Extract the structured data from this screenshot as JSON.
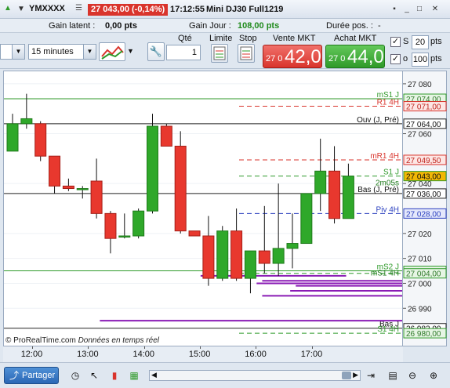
{
  "titlebar": {
    "symbol": "YMXXXX",
    "price": "27 043,00 (-0,14%)",
    "time": "17:12:55",
    "name": "Mini DJ30 Full1219"
  },
  "info": {
    "gain_latent_label": "Gain latent :",
    "gain_latent_value": "0,00 pts",
    "gain_jour_label": "Gain Jour :",
    "gain_jour_value": "108,00 pts",
    "duree_label": "Durée pos. :",
    "duree_value": "-"
  },
  "order": {
    "interval": "15 minutes",
    "qty_label": "Qté",
    "qty_value": "1",
    "limit_label": "Limite",
    "stop_label": "Stop",
    "sell_label": "Vente MKT",
    "sell_small": "27 0",
    "sell_big": "42,0",
    "buy_label": "Achat MKT",
    "buy_small": "27 0",
    "buy_big": "44,0",
    "s_label": "S",
    "s_value": "20",
    "o_value": "100",
    "pts": "pts"
  },
  "chart_data": {
    "type": "candlestick",
    "y_range": [
      26975,
      27085
    ],
    "y_ticks": [
      "27 080",
      "27 060",
      "27 040",
      "27 020",
      "27 010",
      "27 000",
      "26 990"
    ],
    "x_ticks": [
      "12:00",
      "13:00",
      "14:00",
      "15:00",
      "16:00",
      "17:00"
    ],
    "candles": [
      {
        "o": 27053,
        "h": 27068,
        "l": 27053,
        "c": 27064
      },
      {
        "o": 27064,
        "h": 27076,
        "l": 27062,
        "c": 27066
      },
      {
        "o": 27064,
        "h": 27065,
        "l": 27049,
        "c": 27051
      },
      {
        "o": 27051,
        "h": 27051,
        "l": 27036,
        "c": 27039
      },
      {
        "o": 27039,
        "h": 27042,
        "l": 27037,
        "c": 27038
      },
      {
        "o": 27038,
        "h": 27039,
        "l": 27034,
        "c": 27038
      },
      {
        "o": 27041,
        "h": 27050,
        "l": 27026,
        "c": 27028
      },
      {
        "o": 27028,
        "h": 27029,
        "l": 27012,
        "c": 27018
      },
      {
        "o": 27019,
        "h": 27028,
        "l": 27018,
        "c": 27019
      },
      {
        "o": 27019,
        "h": 27030,
        "l": 27018,
        "c": 27029
      },
      {
        "o": 27029,
        "h": 27068,
        "l": 27028,
        "c": 27063
      },
      {
        "o": 27063,
        "h": 27064,
        "l": 27055,
        "c": 27055
      },
      {
        "o": 27055,
        "h": 27061,
        "l": 27020,
        "c": 27021
      },
      {
        "o": 27021,
        "h": 27021,
        "l": 27019,
        "c": 27019
      },
      {
        "o": 27019,
        "h": 27027,
        "l": 26999,
        "c": 27002
      },
      {
        "o": 27002,
        "h": 27023,
        "l": 27001,
        "c": 27021
      },
      {
        "o": 27021,
        "h": 27030,
        "l": 27001,
        "c": 27002
      },
      {
        "o": 27002,
        "h": 27013,
        "l": 26996,
        "c": 27013
      },
      {
        "o": 27013,
        "h": 27031,
        "l": 27004,
        "c": 27008
      },
      {
        "o": 27008,
        "h": 27040,
        "l": 27003,
        "c": 27014
      },
      {
        "o": 27014,
        "h": 27028,
        "l": 27006,
        "c": 27016
      },
      {
        "o": 27016,
        "h": 27028,
        "l": 27016,
        "c": 27036
      },
      {
        "o": 27036,
        "h": 27058,
        "l": 27029,
        "c": 27045
      },
      {
        "o": 27045,
        "h": 27055,
        "l": 27024,
        "c": 27026
      },
      {
        "o": 27026,
        "h": 27048,
        "l": 27026,
        "c": 27043
      }
    ],
    "levels": [
      {
        "label": "mS1 J",
        "value": 27074.0,
        "price": "27 074,00",
        "color": "#2f9a2a",
        "style": "solid",
        "tag_bg": "#e6f5e4",
        "tag_fg": "#2f7a2a"
      },
      {
        "label": "R1 4H",
        "value": 27071.0,
        "price": "27 071,00",
        "color": "#d9342c",
        "style": "dashed",
        "tag_bg": "#fde6e4",
        "tag_fg": "#c0251e"
      },
      {
        "label": "Ouv (J, Pré)",
        "value": 27064.0,
        "price": "27 064,00",
        "color": "#222222",
        "style": "solid",
        "tag_bg": "#ffffff",
        "tag_fg": "#111111"
      },
      {
        "label": "mR1 4H",
        "value": 27049.5,
        "price": "27 049,50",
        "color": "#d9342c",
        "style": "dashed",
        "tag_bg": "#fde6e4",
        "tag_fg": "#c0251e"
      },
      {
        "label": "S1 J",
        "value": 27043.0,
        "price": "27 043,00",
        "color": "#2f9a2a",
        "style": "dashed",
        "tag_bg": "#f2b705",
        "tag_fg": "#111111"
      },
      {
        "label": "Bas (J, Pré)",
        "value": 27036.0,
        "price": "27 036,00",
        "color": "#222222",
        "style": "solid",
        "tag_bg": "#ffffff",
        "tag_fg": "#111111"
      },
      {
        "label": "Piv 4H",
        "value": 27028.0,
        "price": "27 028,00",
        "color": "#2a3fbf",
        "style": "dashed",
        "tag_bg": "#e4e8fb",
        "tag_fg": "#2a3fbf"
      },
      {
        "label": "mS2 J",
        "value": 27005.0,
        "price": "27 005,00",
        "color": "#2f9a2a",
        "style": "solid",
        "tag_bg": "#e6f5e4",
        "tag_fg": "#2f7a2a"
      },
      {
        "label": "",
        "value": 27004.0,
        "price": "27 004,00",
        "color": "#2f9a2a",
        "style": "dashed",
        "tag_bg": "#e6f5e4",
        "tag_fg": "#2f7a2a"
      },
      {
        "label": "Bas J",
        "value": 26982.0,
        "price": "26 982,00",
        "color": "#222222",
        "style": "solid",
        "tag_bg": "#ffffff",
        "tag_fg": "#111111"
      },
      {
        "label": "S1 4H",
        "value": 26980.0,
        "price": "26 980,00",
        "color": "#2f9a2a",
        "style": "dashed",
        "tag_bg": "#e6f5e4",
        "tag_fg": "#2f7a2a"
      }
    ],
    "extra_labels": [
      {
        "text": "2m05s",
        "value": 27039.2
      },
      {
        "text": "mS1 4H",
        "value": 27003.2
      }
    ],
    "volume_profile": [
      {
        "y": 27003.0,
        "t0": 15,
        "t1": 17.6
      },
      {
        "y": 27001.0,
        "t0": 16.1,
        "t1": 19.2
      },
      {
        "y": 27000.0,
        "t0": 16.0,
        "t1": 21
      },
      {
        "y": 26999.0,
        "t0": 16.7,
        "t1": 21
      },
      {
        "y": 26997.0,
        "t0": 16.6,
        "t1": 20.5
      },
      {
        "y": 26995.0,
        "t0": 16.1,
        "t1": 19.5
      },
      {
        "y": 26985.0,
        "t0": 13.2,
        "t1": 23.7
      }
    ],
    "watermark": "© ProRealTime.com",
    "watermark_note": "Données en temps réel"
  },
  "bottom": {
    "share_label": "Partager"
  }
}
